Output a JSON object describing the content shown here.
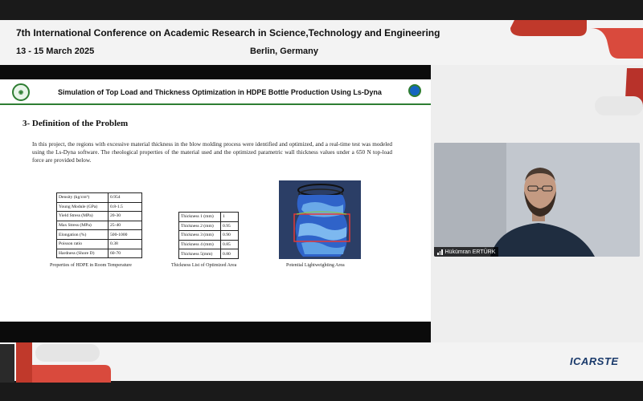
{
  "conference": {
    "title": "7th International Conference on Academic Research in Science,Technology and Engineering",
    "dates": "13 - 15 March 2025",
    "location": "Berlin, Germany",
    "brand": "ICARSTE"
  },
  "slide": {
    "title": "Simulation of Top Load and Thickness Optimization in HDPE Bottle Production Using Ls-Dyna",
    "section_heading": "3- Definition of the Problem",
    "paragraph": "In this project, the regions with excessive material thickness in the blow molding process were identified and optimized, and a real-time test was modeled using the Ls-Dyna software. The rheological properties of the material used and the optimized parametric wall thickness values under a 650 N top-load force are provided below.",
    "properties_table": [
      [
        "Density (kg/cm³)",
        "0.954"
      ],
      [
        "Young Module (GPa)",
        "0.8-1.5"
      ],
      [
        "Yield Stress (MPa)",
        "20-30"
      ],
      [
        "Max Stress (MPa)",
        "25-40"
      ],
      [
        "Elongation (%)",
        "500-1000"
      ],
      [
        "Poisson ratio",
        "0.38"
      ],
      [
        "Hardness (Shore D)",
        "60-70"
      ]
    ],
    "properties_caption": "Properties of HDPE in Room Temperature",
    "thickness_table": [
      [
        "Thickness 1 (mm)",
        "1"
      ],
      [
        "Thickness 2 (mm)",
        "0.95"
      ],
      [
        "Thickness 3 (mm)",
        "0.90"
      ],
      [
        "Thickness 4 (mm)",
        "0.85"
      ],
      [
        "Thickness 5(mm)",
        "0.80"
      ]
    ],
    "thickness_caption": "Thickness List of Optimized Area",
    "image_caption": "Potential Lightweighting Area"
  },
  "webcam": {
    "participant_name": "Hükümran ERTÜRK"
  },
  "colors": {
    "accent_red": "#d94a3d",
    "dark_red": "#b8322a",
    "header_green": "#2e7d32",
    "brand_blue": "#1a3a6b"
  }
}
